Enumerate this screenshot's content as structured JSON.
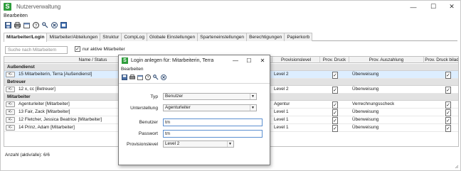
{
  "window": {
    "title": "Nutzerverwaltung",
    "menu": "Bearbeiten",
    "controls": {
      "minimize": "—",
      "maximize": "☐",
      "close": "✕"
    }
  },
  "toolbar_icons": [
    "save-icon",
    "print-icon",
    "calendar-icon",
    "help-icon",
    "key-icon",
    "cancel-icon",
    "export-icon"
  ],
  "tabs": [
    "Mitarbeiter/Login",
    "Mitarbeiter/Abteilungen",
    "Struktur",
    "CompLog",
    "Globale Einstellungen",
    "Sparteneinstellungen",
    "Berechtigungen",
    "Papierkorb"
  ],
  "search": {
    "placeholder": "Suche nach Mitarbeitern"
  },
  "filter": {
    "label": "nur aktive Mitarbeiter",
    "checked": "✓"
  },
  "grid": {
    "headers": {
      "name": "Name / Status",
      "status": "ittlerstatus",
      "level": "Provisionslevel",
      "prov_druck": "Prov. Druck",
      "prov_ausz": "Prov. Auszahlung",
      "prov_druck_bil": "Prov. Druck bilad"
    },
    "groups": [
      {
        "label": "Außendienst",
        "rows": [
          {
            "btn": "<-",
            "name": "15  Mitarbeiterin, Terra  [Außendienst]",
            "level": "Level 2",
            "druck": "✓",
            "ausz": "Überweisung",
            "bil": "✓",
            "selected": true
          }
        ]
      },
      {
        "label": "Betreuer",
        "rows": [
          {
            "btn": "<-",
            "name": "12  x, cc  [Betreuer]",
            "level": "Level 2",
            "druck": "✓",
            "ausz": "Überweisung",
            "bil": "✓",
            "selected": false
          }
        ]
      },
      {
        "label": "Mitarbeiter",
        "rows": [
          {
            "btn": "<-",
            "name": "Agenturleiter  [Mitarbeiter]",
            "level": "Agentur",
            "druck": "✓",
            "ausz": "Verrechnungsscheck",
            "bil": "✓",
            "selected": false
          },
          {
            "btn": "<-",
            "name": "13  Fair, Zack  [Mitarbeiter]",
            "level": "Level 1",
            "druck": "✓",
            "ausz": "Überweisung",
            "bil": "✓",
            "selected": false
          },
          {
            "btn": "<-",
            "name": "12  Fletcher, Jessica Beatrice  [Mitarbeiter]",
            "level": "Level 1",
            "druck": "✓",
            "ausz": "Überweisung",
            "bil": "✓",
            "selected": false
          },
          {
            "btn": "<-",
            "name": "14  Prinz, Adam  [Mitarbeiter]",
            "level": "Level 1",
            "druck": "✓",
            "ausz": "Überweisung",
            "bil": "✓",
            "selected": false
          }
        ]
      }
    ]
  },
  "status": "Anzahl (aktiv/alle): 6/6",
  "dialog": {
    "title": "Login anlegen für: Mitarbeiterin, Terra",
    "menu": "Bearbeiten",
    "controls": {
      "minimize": "—",
      "maximize": "☐",
      "close": "✕"
    },
    "tool_icons": [
      "save-icon",
      "print-icon",
      "calendar-icon",
      "help-icon",
      "key-icon",
      "cancel-icon"
    ],
    "fields": {
      "typ_label": "Typ",
      "typ_value": "Benutzer",
      "unterstellung_label": "Unterstellung",
      "unterstellung_value": "Agenturleiter",
      "benutzer_label": "Benutzer",
      "benutzer_value": "tm",
      "passwort_label": "Passwort",
      "passwort_value": "tm",
      "provisionslevel_label": "Provisionslevel",
      "provisionslevel_value": "Level 2"
    }
  },
  "colors": {
    "brand": "#2e9d3c",
    "selected_row": "#ddeeff",
    "group_row": "#e2e2e2",
    "focus_border": "#5b8fd0"
  }
}
